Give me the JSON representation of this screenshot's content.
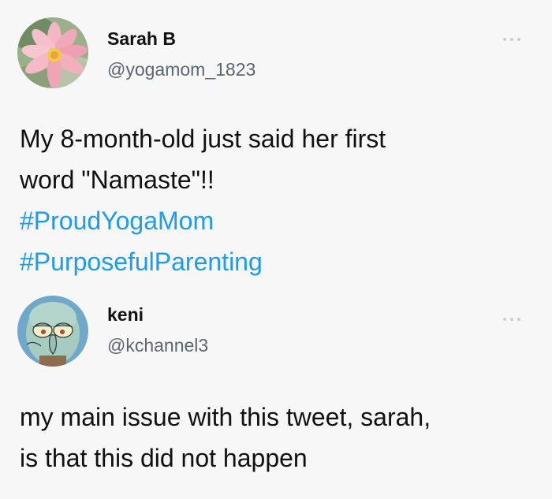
{
  "tweets": [
    {
      "display_name": "Sarah B",
      "handle": "@yogamom_1823",
      "avatar_icon": "lotus-flower-avatar",
      "text_lines": [
        "My 8-month-old just said her first",
        "word \"Namaste\"!!"
      ],
      "hashtags": [
        "#ProudYogaMom",
        "#PurposefulParenting"
      ]
    },
    {
      "display_name": "keni",
      "handle": "@kchannel3",
      "avatar_icon": "cartoon-squid-avatar",
      "text_lines": [
        "my main issue with this tweet, sarah,",
        "is that this did not happen"
      ]
    }
  ],
  "colors": {
    "background": "#f7f7f7",
    "hashtag": "#1d9bf0",
    "handle": "#5b6670"
  }
}
